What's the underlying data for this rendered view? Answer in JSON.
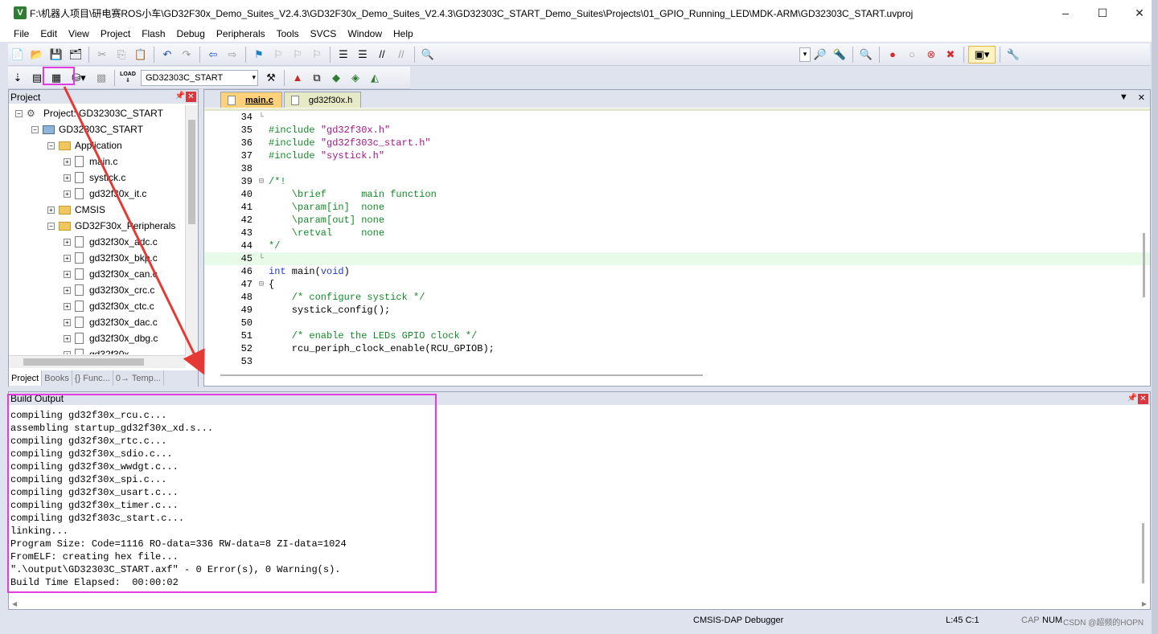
{
  "window": {
    "title": "F:\\机器人项目\\研电赛ROS小车\\GD32F30x_Demo_Suites_V2.4.3\\GD32F30x_Demo_Suites_V2.4.3\\GD32303C_START_Demo_Suites\\Projects\\01_GPIO_Running_LED\\MDK-ARM\\GD32303C_START.uvproj",
    "app_icon": "V",
    "controls": [
      "–",
      "☐",
      "✕"
    ]
  },
  "menu": [
    "File",
    "Edit",
    "View",
    "Project",
    "Flash",
    "Debug",
    "Peripherals",
    "Tools",
    "SVCS",
    "Window",
    "Help"
  ],
  "toolbar2": {
    "target": "GD32303C_START",
    "load_label": "LOAD"
  },
  "project_panel": {
    "title": "Project",
    "tree": [
      {
        "indent": 0,
        "exp": "−",
        "icon": "project",
        "label": "Project: GD32303C_START"
      },
      {
        "indent": 1,
        "exp": "−",
        "icon": "target",
        "label": "GD32303C_START"
      },
      {
        "indent": 2,
        "exp": "−",
        "icon": "folder",
        "label": "Application"
      },
      {
        "indent": 3,
        "exp": "+",
        "icon": "file",
        "label": "main.c"
      },
      {
        "indent": 3,
        "exp": "+",
        "icon": "file",
        "label": "systick.c"
      },
      {
        "indent": 3,
        "exp": "+",
        "icon": "file",
        "label": "gd32f30x_it.c"
      },
      {
        "indent": 2,
        "exp": "+",
        "icon": "folder",
        "label": "CMSIS"
      },
      {
        "indent": 2,
        "exp": "−",
        "icon": "folder",
        "label": "GD32F30x_Peripherals"
      },
      {
        "indent": 3,
        "exp": "+",
        "icon": "file",
        "label": "gd32f30x_adc.c"
      },
      {
        "indent": 3,
        "exp": "+",
        "icon": "file",
        "label": "gd32f30x_bkp.c"
      },
      {
        "indent": 3,
        "exp": "+",
        "icon": "file",
        "label": "gd32f30x_can.c"
      },
      {
        "indent": 3,
        "exp": "+",
        "icon": "file",
        "label": "gd32f30x_crc.c"
      },
      {
        "indent": 3,
        "exp": "+",
        "icon": "file",
        "label": "gd32f30x_ctc.c"
      },
      {
        "indent": 3,
        "exp": "+",
        "icon": "file",
        "label": "gd32f30x_dac.c"
      },
      {
        "indent": 3,
        "exp": "+",
        "icon": "file",
        "label": "gd32f30x_dbg.c"
      },
      {
        "indent": 3,
        "exp": "+",
        "icon": "file",
        "label": "gd32f30x_..."
      }
    ],
    "tabs": [
      "Project",
      "Books",
      "{} Func...",
      "0→ Temp..."
    ]
  },
  "editor": {
    "tabs": [
      "main.c",
      "gd32f30x.h"
    ],
    "active_tab": "main.c",
    "lines": [
      {
        "n": "34",
        "fold": "└",
        "parts": []
      },
      {
        "n": "35",
        "fold": "",
        "parts": [
          {
            "t": "#include ",
            "c": "com"
          },
          {
            "t": "\"gd32f30x.h\"",
            "c": "str"
          }
        ]
      },
      {
        "n": "36",
        "fold": "",
        "parts": [
          {
            "t": "#include ",
            "c": "com"
          },
          {
            "t": "\"gd32f303c_start.h\"",
            "c": "str"
          }
        ]
      },
      {
        "n": "37",
        "fold": "",
        "parts": [
          {
            "t": "#include ",
            "c": "com"
          },
          {
            "t": "\"systick.h\"",
            "c": "str"
          }
        ]
      },
      {
        "n": "38",
        "fold": "",
        "parts": []
      },
      {
        "n": "39",
        "fold": "⊟",
        "parts": [
          {
            "t": "/*!",
            "c": "com"
          }
        ]
      },
      {
        "n": "40",
        "fold": "",
        "parts": [
          {
            "t": "    \\brief      main function",
            "c": "com"
          }
        ]
      },
      {
        "n": "41",
        "fold": "",
        "parts": [
          {
            "t": "    \\param[in]  none",
            "c": "com"
          }
        ]
      },
      {
        "n": "42",
        "fold": "",
        "parts": [
          {
            "t": "    \\param[out] none",
            "c": "com"
          }
        ]
      },
      {
        "n": "43",
        "fold": "",
        "parts": [
          {
            "t": "    \\retval     none",
            "c": "com"
          }
        ]
      },
      {
        "n": "44",
        "fold": "",
        "parts": [
          {
            "t": "*/",
            "c": "com"
          }
        ]
      },
      {
        "n": "45",
        "fold": "└",
        "parts": [
          {
            "t": "",
            "c": ""
          }
        ],
        "highlight": true
      },
      {
        "n": "46",
        "fold": "",
        "parts": [
          {
            "t": "int",
            "c": "kw"
          },
          {
            "t": " main(",
            "c": ""
          },
          {
            "t": "void",
            "c": "kw"
          },
          {
            "t": ")",
            "c": ""
          }
        ]
      },
      {
        "n": "47",
        "fold": "⊟",
        "parts": [
          {
            "t": "{",
            "c": ""
          }
        ]
      },
      {
        "n": "48",
        "fold": "",
        "parts": [
          {
            "t": "    /* configure systick */",
            "c": "com"
          }
        ]
      },
      {
        "n": "49",
        "fold": "",
        "parts": [
          {
            "t": "    systick_config();",
            "c": ""
          }
        ]
      },
      {
        "n": "50",
        "fold": "",
        "parts": []
      },
      {
        "n": "51",
        "fold": "",
        "parts": [
          {
            "t": "    /* enable the LEDs GPIO clock */",
            "c": "com"
          }
        ]
      },
      {
        "n": "52",
        "fold": "",
        "parts": [
          {
            "t": "    rcu_periph_clock_enable(RCU_GPIOB);",
            "c": ""
          }
        ]
      },
      {
        "n": "53",
        "fold": "",
        "parts": []
      }
    ]
  },
  "build_output": {
    "title": "Build Output",
    "lines": [
      "compiling gd32f30x_rcu.c...",
      "assembling startup_gd32f30x_xd.s...",
      "compiling gd32f30x_rtc.c...",
      "compiling gd32f30x_sdio.c...",
      "compiling gd32f30x_wwdgt.c...",
      "compiling gd32f30x_spi.c...",
      "compiling gd32f30x_usart.c...",
      "compiling gd32f30x_timer.c...",
      "compiling gd32f303c_start.c...",
      "linking...",
      "Program Size: Code=1116 RO-data=336 RW-data=8 ZI-data=1024",
      "FromELF: creating hex file...",
      "\".\\output\\GD32303C_START.axf\" - 0 Error(s), 0 Warning(s).",
      "Build Time Elapsed:  00:00:02"
    ]
  },
  "status": {
    "debugger": "CMSIS-DAP Debugger",
    "position": "L:45 C:1",
    "cap": "CAP",
    "num": "NUM",
    "watermark": "CSDN @超频的HOPN"
  },
  "colors": {
    "annotation": "#e23ce0",
    "arrow": "#e53935"
  }
}
